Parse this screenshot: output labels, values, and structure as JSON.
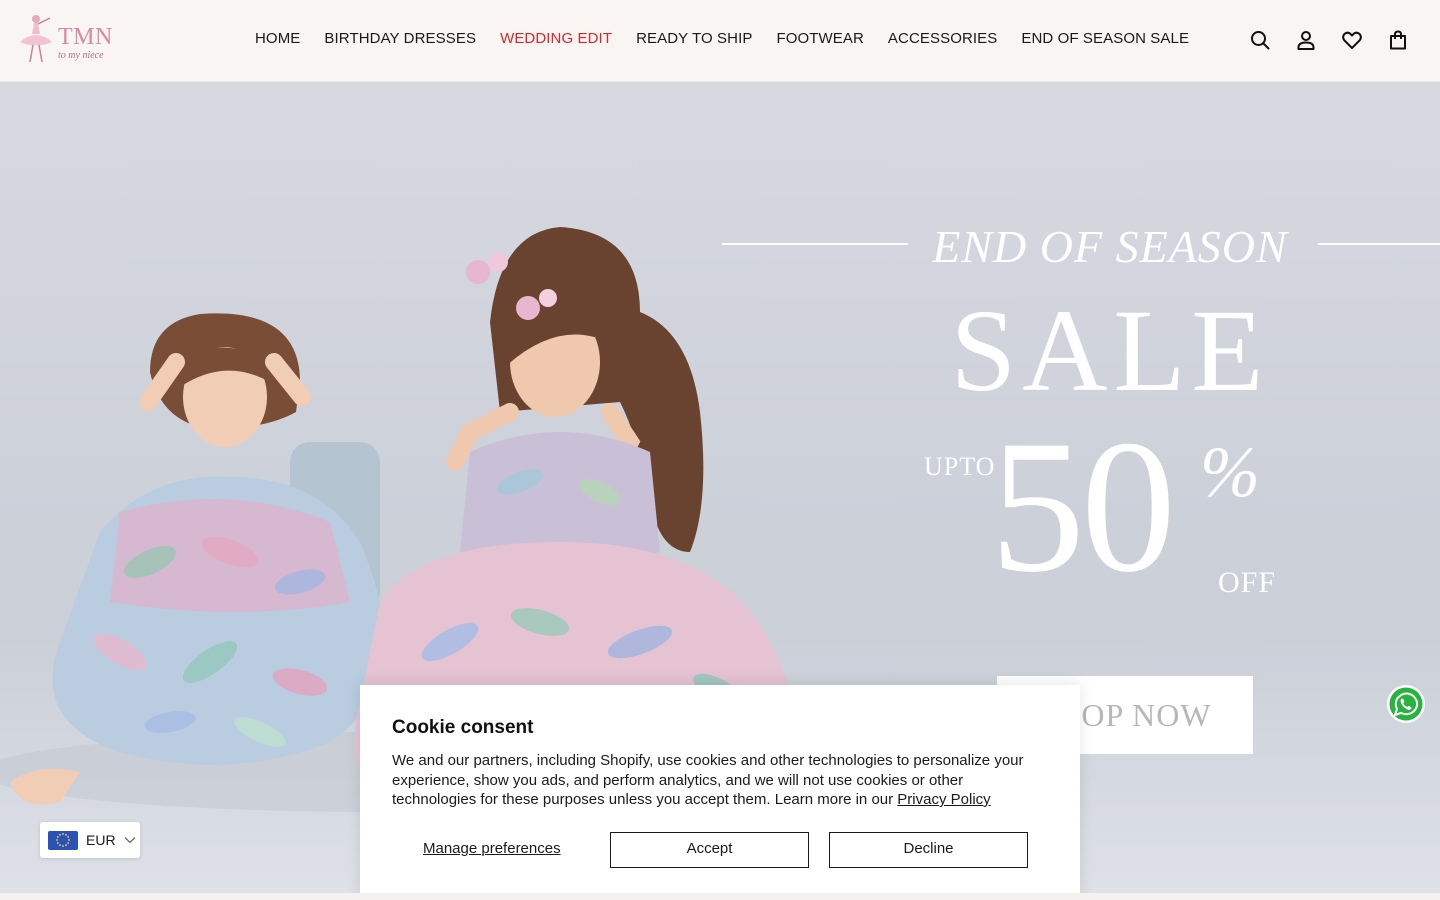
{
  "brand": {
    "logo_text": "TMN",
    "logo_subtext": "to my niece",
    "accent_color": "#d889a4"
  },
  "nav": {
    "items": [
      {
        "label": "HOME"
      },
      {
        "label": "BIRTHDAY DRESSES"
      },
      {
        "label": "WEDDING EDIT"
      },
      {
        "label": "READY TO SHIP"
      },
      {
        "label": "FOOTWEAR"
      },
      {
        "label": "ACCESSORIES"
      },
      {
        "label": "END OF SEASON SALE"
      }
    ],
    "active_item": "WEDDING EDIT",
    "active_color": "#d8262e"
  },
  "header_icons": [
    "search-icon",
    "account-icon",
    "wishlist-heart-icon",
    "cart-bag-icon"
  ],
  "hero": {
    "headline_top": "END OF SEASON",
    "headline_main": "SALE",
    "upto": "UPTO",
    "discount_number": "50",
    "percent_sign": "%",
    "off": "OFF",
    "cta": "SHOP NOW"
  },
  "currency": {
    "code": "EUR",
    "flag_icon": "eu-flag-icon"
  },
  "cookie": {
    "title": "Cookie consent",
    "body": "We and our partners, including Shopify, use cookies and other technologies to personalize your experience, show you ads, and perform analytics, and we will not use cookies or other technologies for these purposes unless you accept them. Learn more in our ",
    "privacy_link": "Privacy Policy",
    "manage_label": "Manage preferences",
    "accept_label": "Accept",
    "decline_label": "Decline"
  },
  "whatsapp_icon": "whatsapp-icon"
}
